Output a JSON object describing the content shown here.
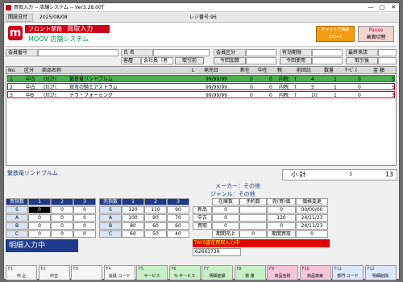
{
  "window": {
    "title": "買取入力 -- 店舗システム -- Ver3.28.00T",
    "controls": [
      "—",
      "□",
      "✕"
    ]
  },
  "info": {
    "date_label": "開設日付",
    "date": "2025/08/08",
    "register_label": "レジ番号:96"
  },
  "banner": {
    "logo": "m",
    "tag": "フロント業務",
    "title": "買取入力",
    "subtitle": "MOOV 店舗システム",
    "chat_btn": "チャットで相談",
    "chat_sub": "Ctrl+3",
    "pause_btn": "Pause",
    "pause_sub": "画面切替"
  },
  "form": {
    "member_no": "会員番号",
    "name": "氏  名",
    "member_type": "会員区分",
    "expiry": "有効期限",
    "last_visit": "最終来店",
    "customer": "客層",
    "customer_value": "会社員（男",
    "trade_btn": "取引前",
    "issue_label": "今回加算",
    "use_label": "今回使用",
    "transfer_label": "取引後"
  },
  "grid": {
    "headers": [
      "No.",
      "区分",
      "商品名称",
      "L",
      "発売日",
      "新在",
      "中在",
      "税",
      "前回比",
      "数量",
      "ｻｰﾋﾞｽ",
      "金 額"
    ],
    "rows": [
      {
        "no": "1",
        "kubun": "中古",
        "maker": "(ｶ)ｺﾅﾐ",
        "name": "繋鉄竜リンドブルム",
        "date": "99/99/99",
        "shin": "0",
        "chu": "0",
        "tax": "内税",
        "arrow": "↑",
        "comp": "4",
        "qty": "1",
        "svc": "0",
        "amt": "5"
      },
      {
        "no": "2",
        "kubun": "中古",
        "maker": "(ｶ)ｺﾅﾐ",
        "name": "双弯の騎士アストラム",
        "date": "99/99/99",
        "shin": "0",
        "chu": "0",
        "tax": "内税",
        "arrow": "↑",
        "comp": "5",
        "qty": "1",
        "svc": "0",
        "amt": "5"
      },
      {
        "no": "3",
        "kubun": "中B",
        "maker": "(ｶ)ｺﾅﾐ",
        "name": "テラ・フォーミング",
        "date": "99/99/99",
        "shin": "0",
        "chu": "0",
        "tax": "内税",
        "arrow": "↑",
        "comp": "10",
        "qty": "1",
        "svc": "0",
        "amt": "3"
      }
    ]
  },
  "detail": {
    "product": "繋鉄竜リンドブルム",
    "maker": "メーカー：その他",
    "genre": "ジャンル：その他",
    "subtotal_label": "小 計",
    "subtotal_qty": "3",
    "subtotal_amt": "13"
  },
  "buy_table": {
    "title": "買指数",
    "cols": [
      "1",
      "2",
      "3"
    ],
    "rows": [
      [
        "S",
        "0",
        "0",
        "0"
      ],
      [
        "A",
        "0",
        "0",
        "0"
      ],
      [
        "B",
        "0",
        "0",
        "0"
      ],
      [
        "C",
        "0",
        "0",
        "0"
      ]
    ]
  },
  "sell_table": {
    "title": "売指数",
    "cols": [
      "1",
      "2",
      "3"
    ],
    "rows": [
      [
        "S",
        "120",
        "110",
        "90"
      ],
      [
        "A",
        "100",
        "90",
        "70"
      ],
      [
        "B",
        "80",
        "60",
        "60"
      ],
      [
        "C",
        "60",
        "50",
        "40"
      ]
    ]
  },
  "stock": {
    "headers": [
      "在庫数",
      "予約数",
      "売(買)価",
      "価格変更"
    ],
    "rows": [
      [
        "新品",
        "0",
        "0",
        "00/00/00"
      ],
      [
        "中古",
        "0",
        "120",
        "24/11/23"
      ],
      [
        "買取",
        "0",
        "0",
        "24/11/23"
      ]
    ],
    "period_label": "期間売上",
    "period_val": "0",
    "period_buy": "期間買取",
    "period_buy_val": "0"
  },
  "status": {
    "mode": "明細入力中",
    "tays": "TAYS査定買取入力中",
    "code": "62663739"
  },
  "fkeys": [
    {
      "n": "F1",
      "l": "中 止",
      "c": ""
    },
    {
      "n": "F2",
      "l": "中古",
      "c": ""
    },
    {
      "n": "F3",
      "l": "",
      "c": ""
    },
    {
      "n": "F4",
      "l": "会員",
      "c": "コード"
    },
    {
      "n": "F5",
      "l": "サービス",
      "c": ""
    },
    {
      "n": "F6",
      "l": "%",
      "c": "サービス"
    },
    {
      "n": "F7",
      "l": "明細金額",
      "c": ""
    },
    {
      "n": "F8",
      "l": "数 量",
      "c": ""
    },
    {
      "n": "F9",
      "l": "商品名称",
      "c": ""
    },
    {
      "n": "F10",
      "l": "商品検索",
      "c": ""
    },
    {
      "n": "F11",
      "l": "部門",
      "c": "コード"
    },
    {
      "n": "F12",
      "l": "明細削除",
      "c": ""
    }
  ],
  "colors": {
    "accent": "#d0021b",
    "selected": "#4caf50",
    "navy": "#1e3a8a",
    "fk_green": "#c8f0c8",
    "fk_pink": "#f4c6d7",
    "fk_blue": "#dde8ff"
  }
}
